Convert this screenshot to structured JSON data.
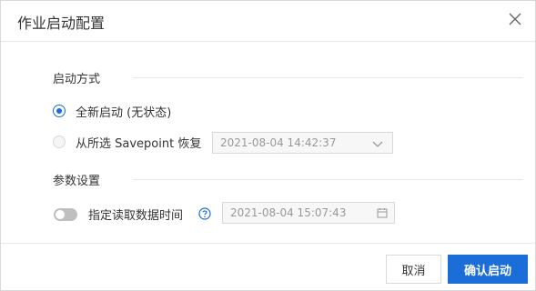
{
  "dialog": {
    "title": "作业启动配置",
    "close_icon": "close-icon"
  },
  "start_mode": {
    "section_title": "启动方式",
    "option_stateless_label": "全新启动 (无状态)",
    "option_savepoint_label": "从所选 Savepoint 恢复",
    "selected": "stateless",
    "savepoint_select_value": "2021-08-04 14:42:37"
  },
  "params": {
    "section_title": "参数设置",
    "toggle_label": "指定读取数据时间",
    "toggle_on": false,
    "date_value": "2021-08-04 15:07:43",
    "help_icon": "question-circle-icon",
    "calendar_icon": "calendar-icon"
  },
  "footer": {
    "cancel_label": "取消",
    "confirm_label": "确认启动"
  },
  "colors": {
    "primary": "#1b6ed8",
    "border": "#d9d9d9",
    "disabled_bg": "#f7f7f7"
  }
}
